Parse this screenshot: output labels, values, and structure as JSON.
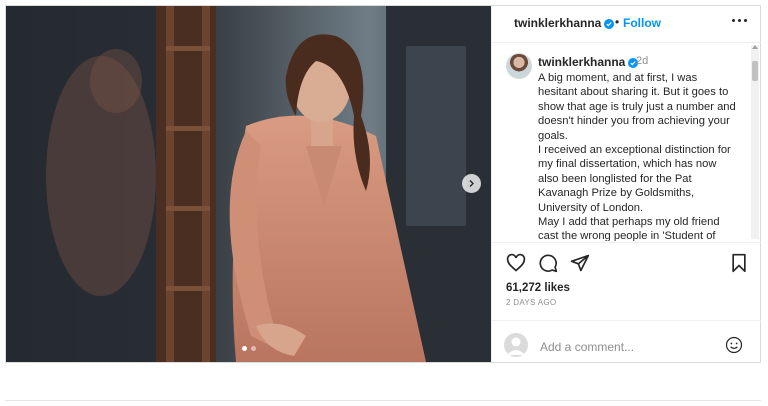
{
  "post": {
    "username": "twinklerkhanna",
    "follow_separator": "•",
    "follow_label": "Follow",
    "time_ago": "2d",
    "caption_paragraphs": [
      "A big moment, and at first, I was hesitant about sharing it. But it goes to show that age is truly just a number and doesn't hinder you from achieving your goals.",
      "I received an exceptional distinction for my final dissertation, which has now also been longlisted for the Pat Kavanagh Prize by Goldsmiths, University of London.",
      "May I add that perhaps my old friend cast the wrong people in 'Student of"
    ],
    "likes_text": "61,272 likes",
    "date_text": "2 DAYS AGO",
    "comment_placeholder": "Add a comment...",
    "carousel": {
      "slides": 2,
      "active": 1
    }
  },
  "colors": {
    "link_blue": "#0095f6",
    "verified_blue": "#0095f6",
    "text": "#262626",
    "muted": "#8e8e8e"
  },
  "icons": [
    "verified-badge-icon",
    "more-options-icon",
    "heart-icon",
    "comment-icon",
    "share-icon",
    "save-icon",
    "emoji-icon",
    "next-arrow-icon"
  ]
}
